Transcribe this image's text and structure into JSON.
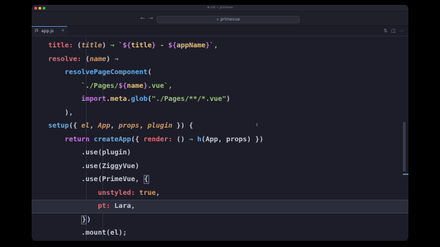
{
  "window": {
    "title": "⌘ zsh — primevue"
  },
  "toolbar": {
    "back_glyph": "←",
    "forward_glyph": "→",
    "command_center": "⌕ primevue"
  },
  "tabs": [
    {
      "label": "app.js",
      "icon": "js-file-icon",
      "close": "×"
    }
  ],
  "tabbar_actions": [
    {
      "icon": "compare-icon",
      "glyph": "⇅"
    },
    {
      "icon": "split-editor-icon",
      "glyph": "◫"
    },
    {
      "icon": "more-icon",
      "glyph": "⋯"
    }
  ],
  "colors": {
    "keyword": "#c678dd",
    "property": "#e06c75",
    "function": "#61afef",
    "string": "#98c379",
    "operator": "#56b6c2",
    "parameter": "#d19a66",
    "background": "#1c1d28"
  },
  "code": [
    [
      "    ",
      "title:",
      " ",
      "(",
      "title",
      ")",
      " ⇒ `",
      "${",
      "title",
      "}",
      " - ",
      "${",
      "appName",
      "}",
      "`,"
    ],
    [
      "    ",
      "resolve:",
      " ",
      "(",
      "name",
      ")",
      " ⇒"
    ],
    [
      "        ",
      "resolvePageComponent",
      "("
    ],
    [
      "            ",
      "`./Pages/",
      "${",
      "name",
      "}",
      ".vue`,"
    ],
    [
      "            ",
      "import",
      ".",
      "meta",
      ".",
      "glob",
      "(",
      "\"./Pages/**/*.vue\"",
      ")"
    ],
    [
      "        ",
      "),"
    ],
    [
      "    ",
      "setup",
      "({ ",
      "el",
      ", ",
      "App",
      ", ",
      "props",
      ", ",
      "plugin",
      " }) {"
    ],
    [
      "        ",
      "return",
      " ",
      "createApp",
      "({ ",
      "render:",
      " () ",
      "⇒",
      " ",
      "h",
      "(App, props) })"
    ],
    [
      "            ",
      ".use(plugin)"
    ],
    [
      "            ",
      ".use(ZiggyVue)"
    ],
    [
      "            ",
      ".use(PrimeVue, ",
      "{"
    ],
    [
      "                ",
      "unstyled:",
      " ",
      "true",
      ","
    ],
    [
      "                ",
      "pt:",
      " Lara,"
    ],
    [
      "            ",
      "}",
      ")"
    ],
    [
      "            ",
      ".mount(el);"
    ]
  ]
}
